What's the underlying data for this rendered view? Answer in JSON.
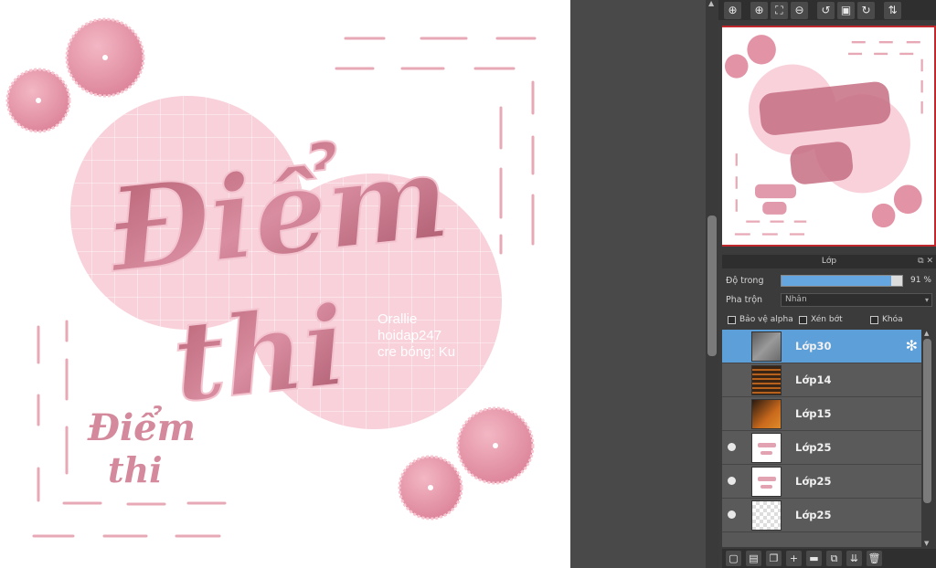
{
  "canvas": {
    "main_line1": "Điểm",
    "main_line2": "thi",
    "small_line1": "Điểm",
    "small_line2": "thi",
    "credit_lines": [
      "Orallie",
      "hoidap247",
      "cre bóng: Ku"
    ],
    "colors": {
      "pink_dark": "#c4707f",
      "pink_mid": "#e69bac",
      "pink_light": "#f9d4dc",
      "dash": "#e8a9b6"
    }
  },
  "toolbar_icons": [
    "zoom-fit-icon",
    "zoom-in-icon",
    "actual-size-icon",
    "zoom-out-icon",
    "rotate-left-icon",
    "fit-window-icon",
    "rotate-right-icon",
    "flip-icon"
  ],
  "layers_panel": {
    "title": "Lớp",
    "opacity_label": "Độ trong",
    "opacity_value": "91 %",
    "opacity_fraction": 0.91,
    "blend_label": "Pha trộn",
    "blend_value": "Nhân",
    "protect_alpha": "Bảo vệ alpha",
    "clipping": "Xén bớt",
    "lock": "Khóa",
    "layers": [
      {
        "name": "Lớp30",
        "selected": true,
        "visible": false,
        "thumb": "gray"
      },
      {
        "name": "Lớp14",
        "selected": false,
        "visible": false,
        "thumb": "orange-lines"
      },
      {
        "name": "Lớp15",
        "selected": false,
        "visible": false,
        "thumb": "orange"
      },
      {
        "name": "Lớp25",
        "selected": false,
        "visible": true,
        "thumb": "lettering"
      },
      {
        "name": "Lớp25",
        "selected": false,
        "visible": true,
        "thumb": "lettering"
      },
      {
        "name": "Lớp25",
        "selected": false,
        "visible": true,
        "thumb": "checker"
      }
    ]
  },
  "bottom_icons": [
    "new-layer-icon",
    "new-layer-alt-icon",
    "duplicate-layer-icon",
    "add-icon",
    "folder-icon",
    "copy-icon",
    "merge-icon",
    "delete-icon"
  ]
}
